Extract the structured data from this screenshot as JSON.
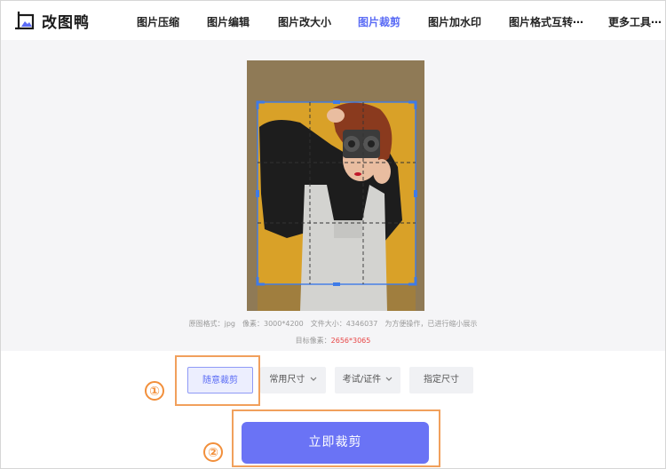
{
  "app": {
    "name": "改图鸭"
  },
  "nav": {
    "items": [
      {
        "label": "图片压缩"
      },
      {
        "label": "图片编辑"
      },
      {
        "label": "图片改大小"
      },
      {
        "label": "图片裁剪"
      },
      {
        "label": "图片加水印"
      },
      {
        "label": "图片格式互转⋯"
      },
      {
        "label": "更多工具⋯"
      }
    ],
    "active_color": "#5b6cf5"
  },
  "info": {
    "line1": "原图格式：jpg　像素：3000*4200　文件大小：4346037　为方便操作，已进行缩小展示",
    "target_label": "目标像素：",
    "target_value": "2656*3065"
  },
  "controls": {
    "free_crop": "随意裁剪",
    "common_size": "常用尺寸",
    "exam_id": "考试/证件",
    "specified_size": "指定尺寸"
  },
  "markers": {
    "one": "①",
    "two": "②"
  },
  "crop_button": {
    "label": "立即裁剪"
  },
  "colors": {
    "accent": "#5b6cf5",
    "button": "#6a73f5",
    "highlight": "#f1a05c",
    "target_red": "#e84646"
  }
}
